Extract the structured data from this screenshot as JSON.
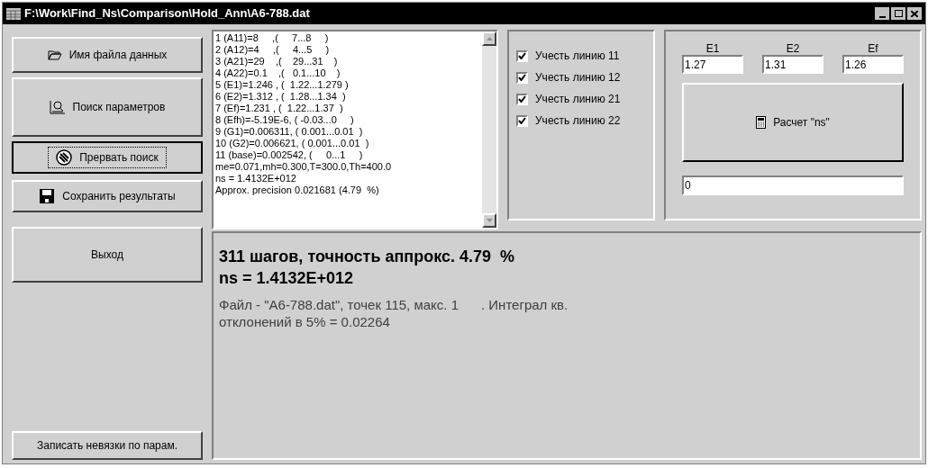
{
  "window": {
    "title": "F:\\Work\\Find_Ns\\Comparison\\Hold_Ann\\A6-788.dat"
  },
  "buttons": [
    {
      "label": "Имя файла данных",
      "kind": "folder",
      "focused": false
    },
    {
      "label": "Поиск параметров",
      "kind": "search",
      "focused": false
    },
    {
      "label": "Прервать поиск",
      "kind": "stop",
      "focused": true
    },
    {
      "label": "Сохранить результаты",
      "kind": "save",
      "focused": false
    },
    {
      "label": "Выход",
      "kind": "plain",
      "focused": false
    }
  ],
  "bottom_button": {
    "label": "Записать невязки по парам."
  },
  "log": [
    "1 (A11)=8     ,(     7...8     )",
    "2 (A12)=4     ,(     4...5     )",
    "3 (A21)=29    ,(    29...31    )",
    "4 (A22)=0.1    ,(   0.1...10    )",
    "5 (E1)=1.246 , (  1.22...1.279 )",
    "6 (E2)=1.312 , (  1.28...1.34  )",
    "7 (Ef)=1.231 , (  1.22...1.37  )",
    "8 (Efh)=-5.19E-6, ( -0.03...0     )",
    "9 (G1)=0.006311, ( 0.001...0.01  )",
    "10 (G2)=0.006621, ( 0.001...0.01  )",
    "11 (base)=0.002542, (     0...1     )",
    "me=0.071,mh=0.300,T=300.0,Th=400.0",
    "ns = 1.4132E+012",
    "Approx. precision 0.021681 (4.79  %)"
  ],
  "checkboxes": [
    {
      "label": "Учесть линию 11",
      "checked": true
    },
    {
      "label": "Учесть линию 12",
      "checked": true
    },
    {
      "label": "Учесть линию 21",
      "checked": true
    },
    {
      "label": "Учесть линию 22",
      "checked": true
    }
  ],
  "energies": [
    {
      "label": "E1",
      "value": "1.27"
    },
    {
      "label": "E2",
      "value": "1.31"
    },
    {
      "label": "Ef",
      "value": "1.26"
    }
  ],
  "calc_button": {
    "label": "Расчет \"ns\""
  },
  "result_field": {
    "value": "0"
  },
  "result": {
    "headline": "311 шагов, точность аппрокс. 4.79  %",
    "ns": "ns = 1.4132E+012",
    "lines": [
      "Файл - \"A6-788.dat\", точек 115, макс. 1      . Интеграл кв.",
      "отклонений в 5% = 0.02264"
    ]
  }
}
